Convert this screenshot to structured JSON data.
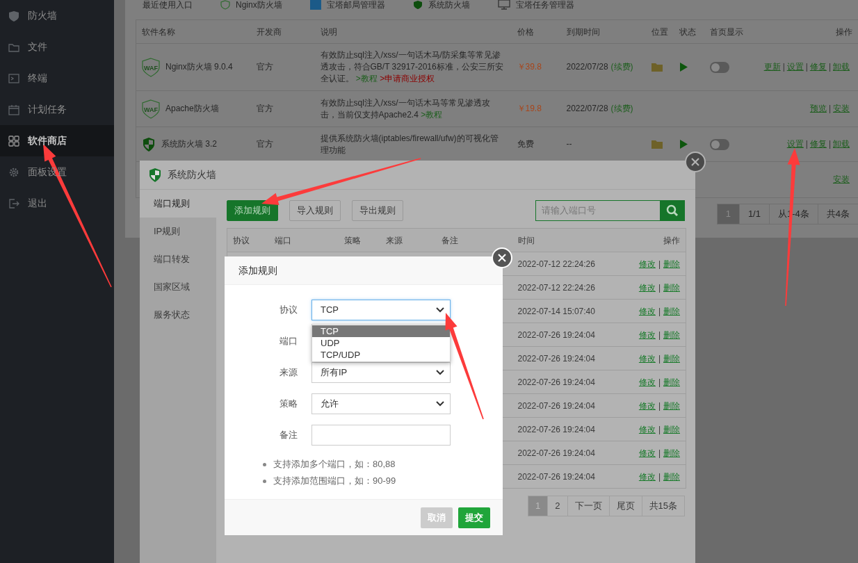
{
  "sidebar": {
    "items": [
      {
        "label": "防火墙",
        "selected": false
      },
      {
        "label": "文件",
        "selected": false
      },
      {
        "label": "终端",
        "selected": false
      },
      {
        "label": "计划任务",
        "selected": false
      },
      {
        "label": "软件商店",
        "selected": true
      },
      {
        "label": "面板设置",
        "selected": false
      },
      {
        "label": "退出",
        "selected": false
      }
    ]
  },
  "recent_entries": {
    "label": "最近使用入口",
    "items": [
      "Nginx防火墙",
      "宝塔邮局管理器",
      "系统防火墙",
      "宝塔任务管理器"
    ]
  },
  "plugin_table": {
    "columns": [
      "软件名称",
      "开发商",
      "说明",
      "价格",
      "到期时间",
      "位置",
      "状态",
      "首页显示",
      "操作"
    ],
    "separator": "|",
    "rows": [
      {
        "kind": "waf",
        "icon_label": "WAF",
        "name": "Nginx防火墙 9.0.4",
        "developer": "官方",
        "description": "有效防止sql注入/xss/一句话木马/防采集等常见渗透攻击，符合GB/T 32917-2016标准，公安三所安全认证。",
        "links": [
          {
            "label": ">教程",
            "kind": "tutorial"
          },
          {
            "label": ">申请商业授权",
            "kind": "license"
          }
        ],
        "price": "￥39.8",
        "expiry": "2022/07/28",
        "renew": "(续费)",
        "installed": true,
        "show_on_home": false,
        "actions": [
          "更新",
          "设置",
          "修复",
          "卸载"
        ]
      },
      {
        "kind": "waf",
        "icon_label": "WAF",
        "name": "Apache防火墙",
        "developer": "官方",
        "description": "有效防止sql注入/xss/一句话木马等常见渗透攻击，当前仅支持Apache2.4",
        "links": [
          {
            "label": ">教程",
            "kind": "tutorial"
          }
        ],
        "price": "￥19.8",
        "expiry": "2022/07/28",
        "renew": "(续费)",
        "installed": false,
        "actions": [
          "预览",
          "安装"
        ]
      },
      {
        "kind": "shield",
        "name": "系统防火墙 3.2",
        "developer": "官方",
        "description": "提供系统防火墙(iptables/firewall/ufw)的可视化管理功能",
        "price": "免费",
        "expiry": "--",
        "installed": true,
        "show_on_home": false,
        "actions": [
          "设置",
          "修复",
          "卸载"
        ]
      },
      {
        "actions": [
          "安装"
        ]
      }
    ]
  },
  "plugin_pagination": [
    {
      "label": "1",
      "selected": true
    },
    {
      "label": "1/1",
      "selected": false
    },
    {
      "label": "从1-4条",
      "selected": false
    },
    {
      "label": "共4条",
      "selected": false
    }
  ],
  "firewall_dialog": {
    "title": "系统防火墙",
    "tabs": [
      {
        "label": "端口规则",
        "selected": true
      },
      {
        "label": "IP规则",
        "selected": false
      },
      {
        "label": "端口转发",
        "selected": false
      },
      {
        "label": "国家区域",
        "selected": false
      },
      {
        "label": "服务状态",
        "selected": false
      }
    ],
    "toolbar": [
      {
        "label": "添加规则",
        "kind": "primary"
      },
      {
        "label": "导入规则",
        "kind": "default"
      },
      {
        "label": "导出规则",
        "kind": "default"
      }
    ],
    "search": {
      "placeholder": "请输入端口号"
    },
    "columns": [
      "协议",
      "端口",
      "策略",
      "来源",
      "备注",
      "时间",
      "操作"
    ],
    "separator": "|",
    "rows": [
      {
        "time": "2022-07-12 22:24:26",
        "actions": [
          "修改",
          "删除"
        ]
      },
      {
        "time": "2022-07-12 22:24:26",
        "actions": [
          "修改",
          "删除"
        ]
      },
      {
        "time": "2022-07-14 15:07:40",
        "actions": [
          "修改",
          "删除"
        ]
      },
      {
        "time": "2022-07-26 19:24:04",
        "actions": [
          "修改",
          "删除"
        ]
      },
      {
        "time": "2022-07-26 19:24:04",
        "actions": [
          "修改",
          "删除"
        ]
      },
      {
        "time": "2022-07-26 19:24:04",
        "actions": [
          "修改",
          "删除"
        ]
      },
      {
        "time": "2022-07-26 19:24:04",
        "actions": [
          "修改",
          "删除"
        ]
      },
      {
        "time": "2022-07-26 19:24:04",
        "actions": [
          "修改",
          "删除"
        ]
      },
      {
        "time": "2022-07-26 19:24:04",
        "actions": [
          "修改",
          "删除"
        ]
      },
      {
        "time": "2022-07-26 19:24:04",
        "actions": [
          "修改",
          "删除"
        ]
      }
    ],
    "pagination": [
      {
        "label": "1",
        "selected": true
      },
      {
        "label": "2",
        "selected": false
      },
      {
        "label": "下一页",
        "selected": false
      },
      {
        "label": "尾页",
        "selected": false
      },
      {
        "label": "共15条",
        "selected": false
      }
    ]
  },
  "add_rule_dialog": {
    "title": "添加规则",
    "fields": [
      {
        "label": "协议",
        "kind": "select",
        "value": "TCP",
        "focused": true,
        "options": [
          {
            "label": "TCP",
            "selected": true
          },
          {
            "label": "UDP",
            "selected": false
          },
          {
            "label": "TCP/UDP",
            "selected": false
          }
        ]
      },
      {
        "label": "端口"
      },
      {
        "label": "来源",
        "kind": "select",
        "value": "所有IP",
        "focused": false
      },
      {
        "label": "策略",
        "kind": "select",
        "value": "允许",
        "focused": false
      },
      {
        "label": "备注",
        "kind": "input"
      }
    ],
    "notes": [
      "支持添加多个端口，如：80,88",
      "支持添加范围端口，如：90-99"
    ],
    "buttons": [
      {
        "label": "取消",
        "kind": "cancel"
      },
      {
        "label": "提交",
        "kind": "submit"
      }
    ]
  }
}
